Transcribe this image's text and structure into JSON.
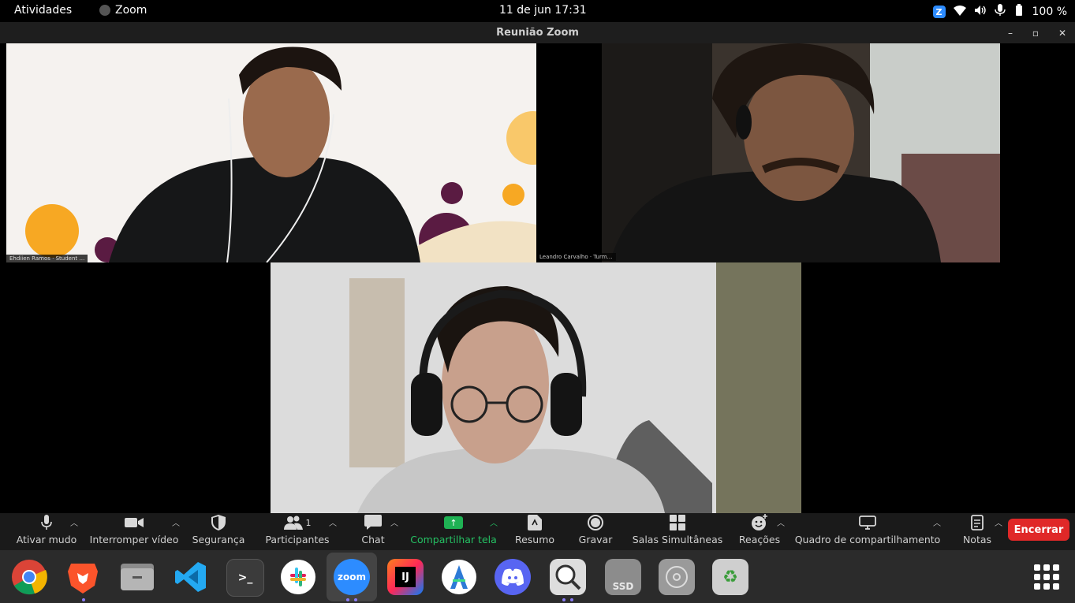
{
  "topbar": {
    "activities": "Atividades",
    "app_name": "Zoom",
    "clock": "11 de jun  17:31",
    "battery": "100 %"
  },
  "window": {
    "title": "Reunião Zoom"
  },
  "video_tiles": [
    {
      "name_label": "Ehdiien Ramos · Student …"
    },
    {
      "name_label": "Leandro Carvalho · Turm…"
    },
    {
      "name_label": ""
    }
  ],
  "toolbar": {
    "mute": "Ativar mudo",
    "video": "Interromper vídeo",
    "security": "Segurança",
    "participants": "Participantes",
    "participants_count": "1",
    "chat": "Chat",
    "share": "Compartilhar tela",
    "summary": "Resumo",
    "record": "Gravar",
    "breakout": "Salas Simultâneas",
    "reactions": "Reações",
    "whiteboard": "Quadro de compartilhamento",
    "notes": "Notas",
    "end": "Encerrar"
  },
  "dock": {
    "apps": [
      "chrome-icon",
      "brave-icon",
      "files-icon",
      "vscode-icon",
      "terminal-icon",
      "slack-icon",
      "zoom-icon",
      "intellij-icon",
      "android-studio-icon",
      "discord-icon",
      "image-viewer-icon",
      "ssd-icon",
      "disc-icon",
      "trash-icon"
    ],
    "zoom_label": "zoom",
    "intellij_label": "IJ",
    "ssd_label": "SSD",
    "terminal_label": ">_"
  },
  "colors": {
    "accent_green": "#25c063",
    "end_red": "#e02828",
    "zoom_blue": "#2d8cff"
  }
}
